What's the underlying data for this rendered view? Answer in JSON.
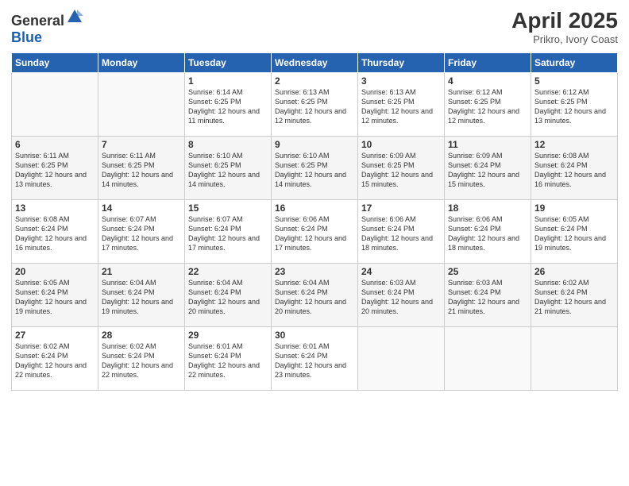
{
  "logo": {
    "general": "General",
    "blue": "Blue"
  },
  "header": {
    "month_year": "April 2025",
    "location": "Prikro, Ivory Coast"
  },
  "days_of_week": [
    "Sunday",
    "Monday",
    "Tuesday",
    "Wednesday",
    "Thursday",
    "Friday",
    "Saturday"
  ],
  "weeks": [
    [
      {
        "day": "",
        "info": ""
      },
      {
        "day": "",
        "info": ""
      },
      {
        "day": "1",
        "info": "Sunrise: 6:14 AM\nSunset: 6:25 PM\nDaylight: 12 hours and 11 minutes."
      },
      {
        "day": "2",
        "info": "Sunrise: 6:13 AM\nSunset: 6:25 PM\nDaylight: 12 hours and 12 minutes."
      },
      {
        "day": "3",
        "info": "Sunrise: 6:13 AM\nSunset: 6:25 PM\nDaylight: 12 hours and 12 minutes."
      },
      {
        "day": "4",
        "info": "Sunrise: 6:12 AM\nSunset: 6:25 PM\nDaylight: 12 hours and 12 minutes."
      },
      {
        "day": "5",
        "info": "Sunrise: 6:12 AM\nSunset: 6:25 PM\nDaylight: 12 hours and 13 minutes."
      }
    ],
    [
      {
        "day": "6",
        "info": "Sunrise: 6:11 AM\nSunset: 6:25 PM\nDaylight: 12 hours and 13 minutes."
      },
      {
        "day": "7",
        "info": "Sunrise: 6:11 AM\nSunset: 6:25 PM\nDaylight: 12 hours and 14 minutes."
      },
      {
        "day": "8",
        "info": "Sunrise: 6:10 AM\nSunset: 6:25 PM\nDaylight: 12 hours and 14 minutes."
      },
      {
        "day": "9",
        "info": "Sunrise: 6:10 AM\nSunset: 6:25 PM\nDaylight: 12 hours and 14 minutes."
      },
      {
        "day": "10",
        "info": "Sunrise: 6:09 AM\nSunset: 6:25 PM\nDaylight: 12 hours and 15 minutes."
      },
      {
        "day": "11",
        "info": "Sunrise: 6:09 AM\nSunset: 6:24 PM\nDaylight: 12 hours and 15 minutes."
      },
      {
        "day": "12",
        "info": "Sunrise: 6:08 AM\nSunset: 6:24 PM\nDaylight: 12 hours and 16 minutes."
      }
    ],
    [
      {
        "day": "13",
        "info": "Sunrise: 6:08 AM\nSunset: 6:24 PM\nDaylight: 12 hours and 16 minutes."
      },
      {
        "day": "14",
        "info": "Sunrise: 6:07 AM\nSunset: 6:24 PM\nDaylight: 12 hours and 17 minutes."
      },
      {
        "day": "15",
        "info": "Sunrise: 6:07 AM\nSunset: 6:24 PM\nDaylight: 12 hours and 17 minutes."
      },
      {
        "day": "16",
        "info": "Sunrise: 6:06 AM\nSunset: 6:24 PM\nDaylight: 12 hours and 17 minutes."
      },
      {
        "day": "17",
        "info": "Sunrise: 6:06 AM\nSunset: 6:24 PM\nDaylight: 12 hours and 18 minutes."
      },
      {
        "day": "18",
        "info": "Sunrise: 6:06 AM\nSunset: 6:24 PM\nDaylight: 12 hours and 18 minutes."
      },
      {
        "day": "19",
        "info": "Sunrise: 6:05 AM\nSunset: 6:24 PM\nDaylight: 12 hours and 19 minutes."
      }
    ],
    [
      {
        "day": "20",
        "info": "Sunrise: 6:05 AM\nSunset: 6:24 PM\nDaylight: 12 hours and 19 minutes."
      },
      {
        "day": "21",
        "info": "Sunrise: 6:04 AM\nSunset: 6:24 PM\nDaylight: 12 hours and 19 minutes."
      },
      {
        "day": "22",
        "info": "Sunrise: 6:04 AM\nSunset: 6:24 PM\nDaylight: 12 hours and 20 minutes."
      },
      {
        "day": "23",
        "info": "Sunrise: 6:04 AM\nSunset: 6:24 PM\nDaylight: 12 hours and 20 minutes."
      },
      {
        "day": "24",
        "info": "Sunrise: 6:03 AM\nSunset: 6:24 PM\nDaylight: 12 hours and 20 minutes."
      },
      {
        "day": "25",
        "info": "Sunrise: 6:03 AM\nSunset: 6:24 PM\nDaylight: 12 hours and 21 minutes."
      },
      {
        "day": "26",
        "info": "Sunrise: 6:02 AM\nSunset: 6:24 PM\nDaylight: 12 hours and 21 minutes."
      }
    ],
    [
      {
        "day": "27",
        "info": "Sunrise: 6:02 AM\nSunset: 6:24 PM\nDaylight: 12 hours and 22 minutes."
      },
      {
        "day": "28",
        "info": "Sunrise: 6:02 AM\nSunset: 6:24 PM\nDaylight: 12 hours and 22 minutes."
      },
      {
        "day": "29",
        "info": "Sunrise: 6:01 AM\nSunset: 6:24 PM\nDaylight: 12 hours and 22 minutes."
      },
      {
        "day": "30",
        "info": "Sunrise: 6:01 AM\nSunset: 6:24 PM\nDaylight: 12 hours and 23 minutes."
      },
      {
        "day": "",
        "info": ""
      },
      {
        "day": "",
        "info": ""
      },
      {
        "day": "",
        "info": ""
      }
    ]
  ]
}
